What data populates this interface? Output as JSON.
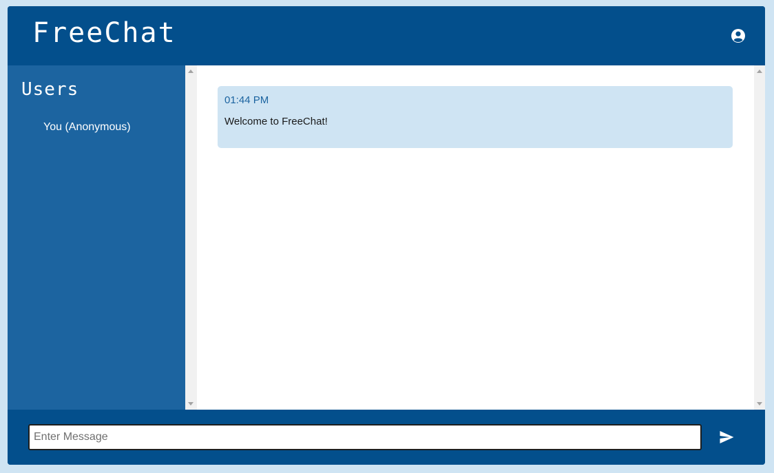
{
  "header": {
    "title": "FreeChat",
    "account_icon": "user-circle-icon"
  },
  "sidebar": {
    "title": "Users",
    "users": [
      "You (Anonymous)"
    ]
  },
  "messages": [
    {
      "time": "01:44 PM",
      "text": "Welcome to FreeChat!"
    }
  ],
  "composer": {
    "placeholder": "Enter Message",
    "value": "",
    "send_icon": "send-icon"
  },
  "colors": {
    "page_background": "#cfe4f3",
    "header": "#034f8c",
    "sidebar": "#1c64a0",
    "message_bubble": "#cfe4f3",
    "timestamp": "#1c64a0"
  }
}
